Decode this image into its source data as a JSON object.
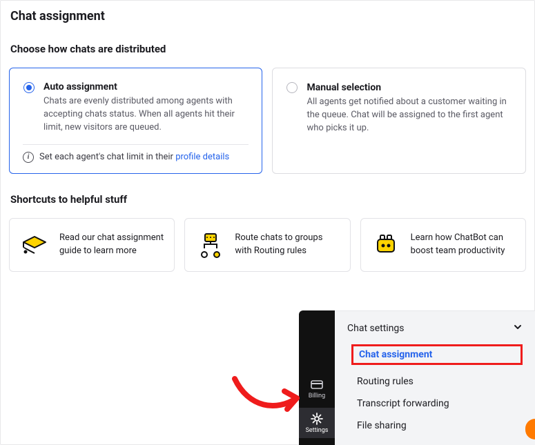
{
  "page_title": "Chat assignment",
  "distribute_heading": "Choose how chats are distributed",
  "options": {
    "auto": {
      "title": "Auto assignment",
      "desc": "Chats are evenly distributed among agents with accepting chats status. When all agents hit their limit, new visitors are queued.",
      "hint_prefix": "Set each agent's chat limit in their ",
      "hint_link": "profile details"
    },
    "manual": {
      "title": "Manual selection",
      "desc": "All agents get notified about a customer waiting in the queue. Chat will be assigned to the first agent who picks it up."
    }
  },
  "shortcuts_heading": "Shortcuts to helpful stuff",
  "shortcuts": [
    {
      "icon": "graduation-cap",
      "text": "Read our chat assignment guide to learn more"
    },
    {
      "icon": "routing",
      "text": "Route chats to groups with Routing rules"
    },
    {
      "icon": "robot",
      "text": "Learn how ChatBot can boost team productivity"
    }
  ],
  "rail": {
    "billing": "Billing",
    "settings": "Settings"
  },
  "panel": {
    "header": "Chat settings",
    "items": [
      "Chat assignment",
      "Routing rules",
      "Transcript forwarding",
      "File sharing"
    ]
  }
}
